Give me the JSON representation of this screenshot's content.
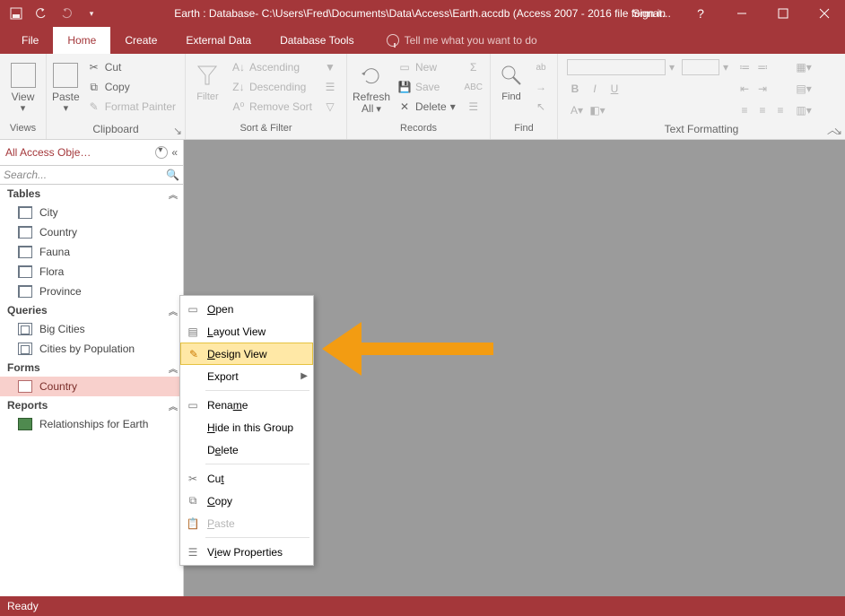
{
  "titlebar": {
    "title": "Earth : Database- C:\\Users\\Fred\\Documents\\Data\\Access\\Earth.accdb (Access 2007 - 2016 file format...",
    "sign_in": "Sign in",
    "help": "?"
  },
  "tabs": {
    "file": "File",
    "home": "Home",
    "create": "Create",
    "external": "External Data",
    "dbtools": "Database Tools",
    "tell_me": "Tell me what you want to do"
  },
  "ribbon": {
    "views": {
      "label": "Views",
      "view": "View"
    },
    "clipboard": {
      "label": "Clipboard",
      "paste": "Paste",
      "cut": "Cut",
      "copy": "Copy",
      "format_painter": "Format Painter"
    },
    "sortfilter": {
      "label": "Sort & Filter",
      "filter": "Filter",
      "asc": "Ascending",
      "desc": "Descending",
      "remove": "Remove Sort"
    },
    "records": {
      "label": "Records",
      "refresh": "Refresh All",
      "new": "New",
      "save": "Save",
      "delete": "Delete"
    },
    "find": {
      "label": "Find",
      "find": "Find"
    },
    "textfmt": {
      "label": "Text Formatting"
    }
  },
  "nav": {
    "header": "All Access Obje…",
    "search": "Search...",
    "groups": {
      "tables": {
        "label": "Tables",
        "items": [
          "City",
          "Country",
          "Fauna",
          "Flora",
          "Province"
        ]
      },
      "queries": {
        "label": "Queries",
        "items": [
          "Big Cities",
          "Cities by Population"
        ]
      },
      "forms": {
        "label": "Forms",
        "items": [
          "Country"
        ]
      },
      "reports": {
        "label": "Reports",
        "items": [
          "Relationships for Earth"
        ]
      }
    }
  },
  "context_menu": {
    "open": "pen",
    "layout": "ayout View",
    "design": "esign View",
    "export": "Export",
    "rename": "Rena",
    "rename2": "e",
    "hide": "ide in this Group",
    "delete": "elete",
    "cut": "Cu",
    "copy": "opy",
    "paste": "aste",
    "props": "iew Properties"
  },
  "status": {
    "text": "Ready"
  }
}
